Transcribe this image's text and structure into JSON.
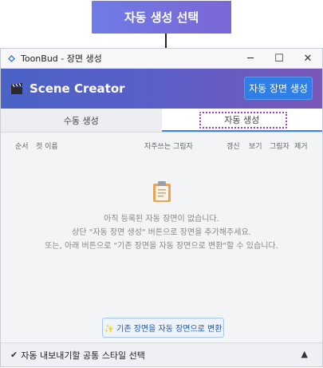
{
  "callout": {
    "label": "자동 생성 선택"
  },
  "window": {
    "title": "ToonBud - 장면 생성",
    "controls": {
      "minimize": "─",
      "maximize": "☐",
      "close": "✕"
    }
  },
  "header": {
    "title": "Scene Creator",
    "auto_create_button": "자동 장면 생성"
  },
  "tabs": [
    {
      "label": "수동 생성",
      "active": false
    },
    {
      "label": "자동 생성",
      "active": true
    }
  ],
  "table": {
    "columns": [
      "순서",
      "컷 이름",
      "자주쓰는 그림자",
      "갱신",
      "보기",
      "그림자",
      "제거"
    ]
  },
  "empty_state": {
    "line1": "아직 등록된 자동 장면이 없습니다.",
    "line2": "상단 \"자동 장면 생성\" 버튼으로 장면을 추가해주세요.",
    "line3": "또는, 아래 버튼으로 \"기존 장면을 자동 장면으로 변환\"할 수 있습니다."
  },
  "convert_button": "✨ 기존 장면을 자동 장면으로 변환",
  "bottom_bar": {
    "check": "✔",
    "label": "자동 내보내기할 공통 스타일 선택",
    "collapse": "▲"
  },
  "colors": {
    "accent": "#2f7fe6",
    "header_start": "#4b63c6",
    "header_end": "#7a58b8",
    "highlight": "#a03fd8"
  }
}
